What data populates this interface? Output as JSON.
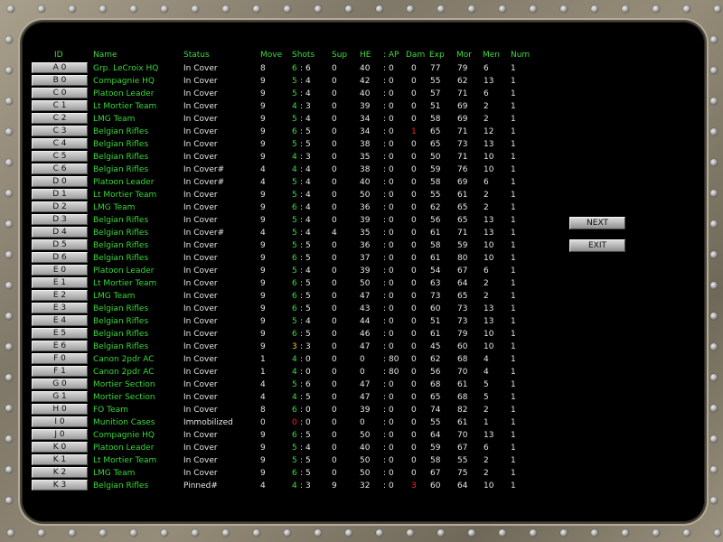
{
  "headers": {
    "id": "ID",
    "name": "Name",
    "status": "Status",
    "move": "Move",
    "shots": "Shots",
    "sup": "Sup",
    "he": "HE",
    "ap": ": AP",
    "dam": "Dam",
    "exp": "Exp",
    "mor": "Mor",
    "men": "Men",
    "num": "Num"
  },
  "buttons": {
    "next": "NEXT",
    "exit": "EXIT"
  },
  "colors": {
    "name_text": "#39d839",
    "highlight": "#ff2020",
    "panel_bg": "#000000"
  },
  "rows": [
    {
      "id": "A 0",
      "name": "Grp. LeCroix HQ",
      "status": "In Cover",
      "move": "8",
      "s1": "6",
      "s2": "6",
      "sup": "0",
      "he": "40",
      "ap": "0",
      "dam": "0",
      "exp": "77",
      "mor": "79",
      "men": "6",
      "num": "1"
    },
    {
      "id": "B 0",
      "name": "Compagnie HQ",
      "status": "In Cover",
      "move": "9",
      "s1": "5",
      "s2": "4",
      "sup": "0",
      "he": "42",
      "ap": "0",
      "dam": "0",
      "exp": "55",
      "mor": "62",
      "men": "13",
      "num": "1"
    },
    {
      "id": "C 0",
      "name": "Platoon Leader",
      "status": "In Cover",
      "move": "9",
      "s1": "5",
      "s2": "4",
      "sup": "0",
      "he": "40",
      "ap": "0",
      "dam": "0",
      "exp": "57",
      "mor": "71",
      "men": "6",
      "num": "1"
    },
    {
      "id": "C 1",
      "name": "Lt Mortier Team",
      "status": "In Cover",
      "move": "9",
      "s1": "4",
      "s2": "3",
      "sup": "0",
      "he": "39",
      "ap": "0",
      "dam": "0",
      "exp": "51",
      "mor": "69",
      "men": "2",
      "num": "1"
    },
    {
      "id": "C 2",
      "name": "LMG Team",
      "status": "In Cover",
      "move": "9",
      "s1": "5",
      "s2": "4",
      "sup": "0",
      "he": "34",
      "ap": "0",
      "dam": "0",
      "exp": "58",
      "mor": "69",
      "men": "2",
      "num": "1"
    },
    {
      "id": "C 3",
      "name": "Belgian Rifles",
      "status": "In Cover",
      "move": "9",
      "s1": "6",
      "s2": "5",
      "sup": "0",
      "he": "34",
      "ap": "0",
      "dam": "1",
      "dam_red": true,
      "exp": "65",
      "mor": "71",
      "men": "12",
      "num": "1"
    },
    {
      "id": "C 4",
      "name": "Belgian Rifles",
      "status": "In Cover",
      "move": "9",
      "s1": "5",
      "s2": "5",
      "sup": "0",
      "he": "38",
      "ap": "0",
      "dam": "0",
      "exp": "65",
      "mor": "73",
      "men": "13",
      "num": "1"
    },
    {
      "id": "C 5",
      "name": "Belgian Rifles",
      "status": "In Cover",
      "move": "9",
      "s1": "4",
      "s2": "3",
      "sup": "0",
      "he": "35",
      "ap": "0",
      "dam": "0",
      "exp": "50",
      "mor": "71",
      "men": "10",
      "num": "1"
    },
    {
      "id": "C 6",
      "name": "Belgian Rifles",
      "status": "In Cover#",
      "move": "4",
      "s1": "4",
      "s2": "4",
      "sup": "0",
      "he": "38",
      "ap": "0",
      "dam": "0",
      "exp": "59",
      "mor": "76",
      "men": "10",
      "num": "1"
    },
    {
      "id": "D 0",
      "name": "Platoon Leader",
      "status": "In Cover#",
      "move": "4",
      "s1": "5",
      "s2": "4",
      "sup": "0",
      "he": "40",
      "ap": "0",
      "dam": "0",
      "exp": "58",
      "mor": "69",
      "men": "6",
      "num": "1"
    },
    {
      "id": "D 1",
      "name": "Lt Mortier Team",
      "status": "In Cover",
      "move": "9",
      "s1": "5",
      "s2": "4",
      "sup": "0",
      "he": "50",
      "ap": "0",
      "dam": "0",
      "exp": "55",
      "mor": "61",
      "men": "2",
      "num": "1"
    },
    {
      "id": "D 2",
      "name": "LMG Team",
      "status": "In Cover",
      "move": "9",
      "s1": "6",
      "s2": "4",
      "sup": "0",
      "he": "36",
      "ap": "0",
      "dam": "0",
      "exp": "62",
      "mor": "65",
      "men": "2",
      "num": "1"
    },
    {
      "id": "D 3",
      "name": "Belgian Rifles",
      "status": "In Cover",
      "move": "9",
      "s1": "5",
      "s2": "4",
      "sup": "0",
      "he": "39",
      "ap": "0",
      "dam": "0",
      "exp": "56",
      "mor": "65",
      "men": "13",
      "num": "1"
    },
    {
      "id": "D 4",
      "name": "Belgian Rifles",
      "status": "In Cover#",
      "move": "4",
      "s1": "5",
      "s2": "4",
      "sup": "4",
      "he": "35",
      "ap": "0",
      "dam": "0",
      "exp": "61",
      "mor": "71",
      "men": "13",
      "num": "1"
    },
    {
      "id": "D 5",
      "name": "Belgian Rifles",
      "status": "In Cover",
      "move": "9",
      "s1": "5",
      "s2": "5",
      "sup": "0",
      "he": "36",
      "ap": "0",
      "dam": "0",
      "exp": "58",
      "mor": "59",
      "men": "10",
      "num": "1"
    },
    {
      "id": "D 6",
      "name": "Belgian Rifles",
      "status": "In Cover",
      "move": "9",
      "s1": "6",
      "s2": "5",
      "sup": "0",
      "he": "37",
      "ap": "0",
      "dam": "0",
      "exp": "61",
      "mor": "80",
      "men": "10",
      "num": "1"
    },
    {
      "id": "E 0",
      "name": "Platoon Leader",
      "status": "In Cover",
      "move": "9",
      "s1": "5",
      "s2": "4",
      "sup": "0",
      "he": "39",
      "ap": "0",
      "dam": "0",
      "exp": "54",
      "mor": "67",
      "men": "6",
      "num": "1"
    },
    {
      "id": "E 1",
      "name": "Lt Mortier Team",
      "status": "In Cover",
      "move": "9",
      "s1": "6",
      "s2": "5",
      "sup": "0",
      "he": "50",
      "ap": "0",
      "dam": "0",
      "exp": "63",
      "mor": "64",
      "men": "2",
      "num": "1"
    },
    {
      "id": "E 2",
      "name": "LMG Team",
      "status": "In Cover",
      "move": "9",
      "s1": "6",
      "s2": "5",
      "sup": "0",
      "he": "47",
      "ap": "0",
      "dam": "0",
      "exp": "73",
      "mor": "65",
      "men": "2",
      "num": "1"
    },
    {
      "id": "E 3",
      "name": "Belgian Rifles",
      "status": "In Cover",
      "move": "9",
      "s1": "6",
      "s2": "5",
      "sup": "0",
      "he": "43",
      "ap": "0",
      "dam": "0",
      "exp": "60",
      "mor": "73",
      "men": "13",
      "num": "1"
    },
    {
      "id": "E 4",
      "name": "Belgian Rifles",
      "status": "In Cover",
      "move": "9",
      "s1": "5",
      "s2": "4",
      "sup": "0",
      "he": "44",
      "ap": "0",
      "dam": "0",
      "exp": "51",
      "mor": "73",
      "men": "13",
      "num": "1"
    },
    {
      "id": "E 5",
      "name": "Belgian Rifles",
      "status": "In Cover",
      "move": "9",
      "s1": "6",
      "s2": "5",
      "sup": "0",
      "he": "46",
      "ap": "0",
      "dam": "0",
      "exp": "61",
      "mor": "79",
      "men": "10",
      "num": "1"
    },
    {
      "id": "E 6",
      "name": "Belgian Rifles",
      "status": "In Cover",
      "move": "9",
      "s1": "3",
      "s1_yellow": true,
      "s2": "3",
      "sup": "0",
      "he": "47",
      "ap": "0",
      "dam": "0",
      "exp": "45",
      "mor": "60",
      "men": "10",
      "num": "1"
    },
    {
      "id": "F 0",
      "name": "Canon 2pdr AC",
      "status": "In Cover",
      "move": "1",
      "s1": "4",
      "s2": "0",
      "sup": "0",
      "he": "0",
      "ap": "80",
      "dam": "0",
      "exp": "62",
      "mor": "68",
      "men": "4",
      "num": "1"
    },
    {
      "id": "F 1",
      "name": "Canon 2pdr AC",
      "status": "In Cover",
      "move": "1",
      "s1": "4",
      "s2": "0",
      "sup": "0",
      "he": "0",
      "ap": "80",
      "dam": "0",
      "exp": "56",
      "mor": "70",
      "men": "4",
      "num": "1"
    },
    {
      "id": "G 0",
      "name": "Mortier Section",
      "status": "In Cover",
      "move": "4",
      "s1": "5",
      "s2": "6",
      "sup": "0",
      "he": "47",
      "ap": "0",
      "dam": "0",
      "exp": "68",
      "mor": "61",
      "men": "5",
      "num": "1"
    },
    {
      "id": "G 1",
      "name": "Mortier Section",
      "status": "In Cover",
      "move": "4",
      "s1": "4",
      "s2": "5",
      "sup": "0",
      "he": "47",
      "ap": "0",
      "dam": "0",
      "exp": "65",
      "mor": "68",
      "men": "5",
      "num": "1"
    },
    {
      "id": "H 0",
      "name": "FO Team",
      "status": "In Cover",
      "move": "8",
      "s1": "6",
      "s2": "0",
      "sup": "0",
      "he": "39",
      "ap": "0",
      "dam": "0",
      "exp": "74",
      "mor": "82",
      "men": "2",
      "num": "1"
    },
    {
      "id": "I 0",
      "name": "Munition Cases",
      "status": "Immobilized",
      "move": "0",
      "s1": "0",
      "s1_red": true,
      "s2": "0",
      "sup": "0",
      "he": "0",
      "ap": "0",
      "dam": "0",
      "exp": "55",
      "mor": "61",
      "men": "1",
      "num": "1"
    },
    {
      "id": "J 0",
      "name": "Compagnie HQ",
      "status": "In Cover",
      "move": "9",
      "s1": "6",
      "s2": "5",
      "sup": "0",
      "he": "50",
      "ap": "0",
      "dam": "0",
      "exp": "64",
      "mor": "70",
      "men": "13",
      "num": "1"
    },
    {
      "id": "K 0",
      "name": "Platoon Leader",
      "status": "In Cover",
      "move": "9",
      "s1": "5",
      "s2": "4",
      "sup": "0",
      "he": "40",
      "ap": "0",
      "dam": "0",
      "exp": "59",
      "mor": "67",
      "men": "6",
      "num": "1"
    },
    {
      "id": "K 1",
      "name": "Lt Mortier Team",
      "status": "In Cover",
      "move": "9",
      "s1": "5",
      "s2": "5",
      "sup": "0",
      "he": "50",
      "ap": "0",
      "dam": "0",
      "exp": "58",
      "mor": "55",
      "men": "2",
      "num": "1"
    },
    {
      "id": "K 2",
      "name": "LMG Team",
      "status": "In Cover",
      "move": "9",
      "s1": "6",
      "s2": "5",
      "sup": "0",
      "he": "50",
      "ap": "0",
      "dam": "0",
      "exp": "67",
      "mor": "75",
      "men": "2",
      "num": "1"
    },
    {
      "id": "K 3",
      "name": "Belgian Rifles",
      "status": "Pinned#",
      "move": "4",
      "s1": "4",
      "s2": "3",
      "sup": "9",
      "he": "32",
      "ap": "0",
      "dam": "3",
      "dam_red": true,
      "exp": "60",
      "mor": "64",
      "men": "10",
      "num": "1"
    }
  ]
}
